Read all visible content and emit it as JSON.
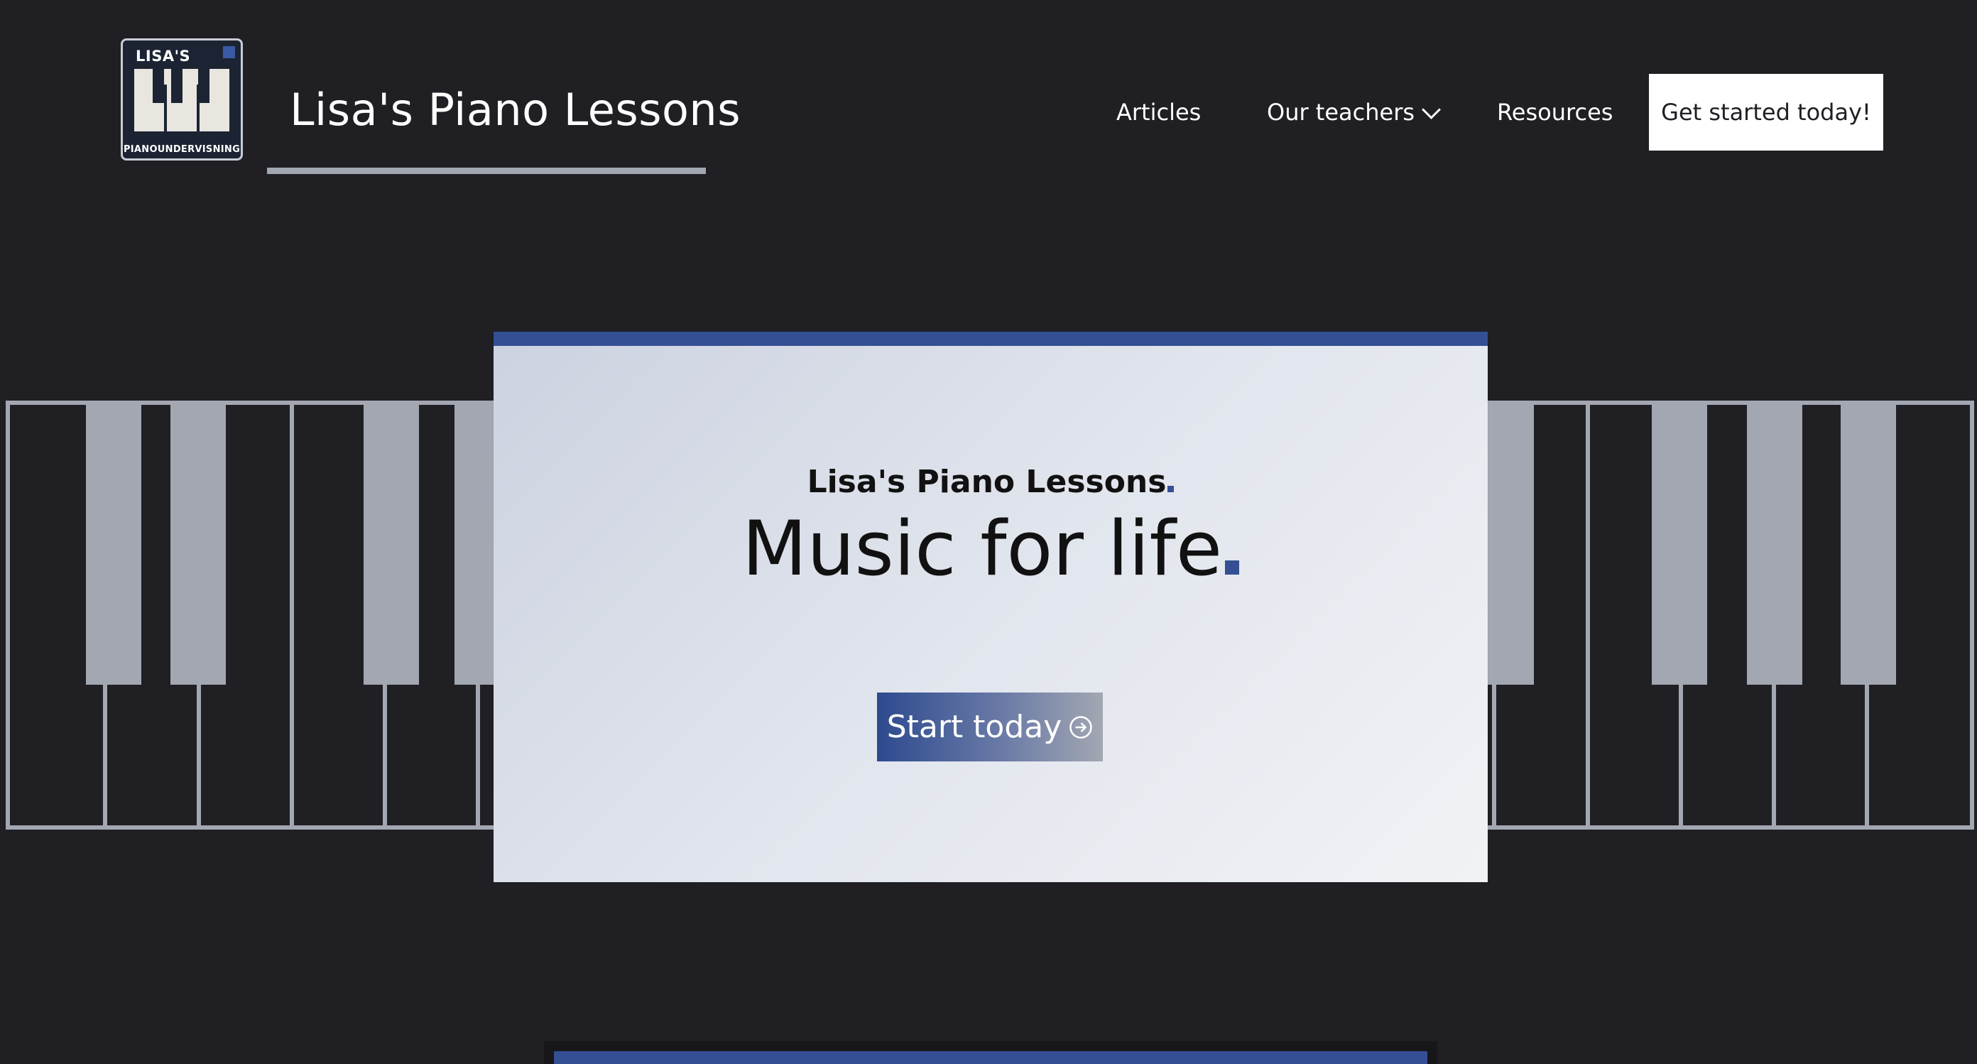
{
  "logo": {
    "top_text": "LISA'S",
    "bottom_text": "PIANOUNDERVISNING"
  },
  "header": {
    "site_title": "Lisa's Piano Lessons"
  },
  "nav": {
    "articles": "Articles",
    "teachers": "Our teachers",
    "resources": "Resources",
    "cta": "Get started today!"
  },
  "hero": {
    "subtitle": "Lisa's Piano Lessons",
    "title": "Music for life",
    "button": "Start today"
  },
  "colors": {
    "background": "#1f1f24",
    "accent": "#344f93",
    "piano_keys": "#a3a7b2",
    "hero_bg": "#e1e5ed"
  },
  "icons": {
    "teachers_dropdown": "chevron-down-icon",
    "start_button": "arrow-right-circle-icon"
  }
}
